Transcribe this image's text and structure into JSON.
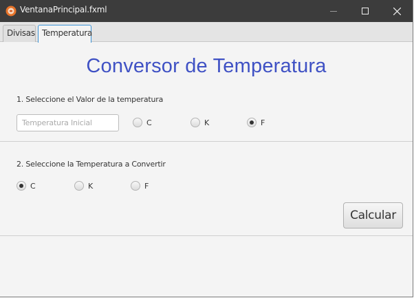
{
  "window": {
    "title": "VentanaPrincipal.fxml",
    "icons": {
      "app": "app-logo-icon",
      "minimize": "minimize-icon",
      "maximize": "maximize-icon",
      "close": "close-icon"
    }
  },
  "tabs": [
    {
      "label": "Divisas",
      "selected": false
    },
    {
      "label": "Temperatura",
      "selected": true
    }
  ],
  "main": {
    "heading": "Conversor de Temperatura",
    "step1": {
      "label": "1. Seleccione el Valor de la temperatura",
      "input_value": "",
      "input_placeholder": "Temperatura Inicial",
      "options": [
        {
          "label": "C",
          "selected": false
        },
        {
          "label": "K",
          "selected": false
        },
        {
          "label": "F",
          "selected": true
        }
      ]
    },
    "step2": {
      "label": "2. Seleccione la Temperatura a Convertir",
      "options": [
        {
          "label": "C",
          "selected": true
        },
        {
          "label": "K",
          "selected": false
        },
        {
          "label": "F",
          "selected": false
        }
      ]
    },
    "calculate_label": "Calcular"
  },
  "colors": {
    "titlebar": "#3c3c3c",
    "heading": "#3f51c4",
    "tab_focus_border": "#3b93d6",
    "background": "#f4f4f4"
  }
}
